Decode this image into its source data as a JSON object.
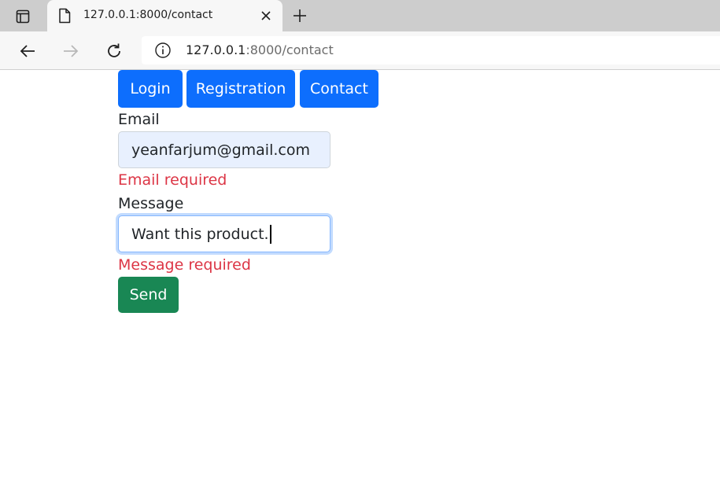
{
  "browser": {
    "tab": {
      "title": "127.0.0.1:8000/contact"
    },
    "address_bar": {
      "host": "127.0.0.1",
      "path": ":8000/contact"
    },
    "icons": {
      "tab_actions": "tab-actions-icon",
      "favicon": "page-icon",
      "close": "close-icon",
      "new_tab": "plus-icon",
      "back": "back-arrow-icon",
      "forward": "forward-arrow-icon",
      "reload": "reload-icon",
      "site_info": "info-icon"
    }
  },
  "nav": {
    "login": "Login",
    "registration": "Registration",
    "contact": "Contact"
  },
  "form": {
    "email_label": "Email",
    "email_value": "yeanfarjum@gmail.com",
    "email_error": "Email required",
    "message_label": "Message",
    "message_value": "Want this product.",
    "message_error": "Message required",
    "send_label": "Send"
  },
  "colors": {
    "primary": "#0d6efd",
    "success": "#198754",
    "danger": "#dc3545",
    "autofill": "#e8f0fe"
  }
}
